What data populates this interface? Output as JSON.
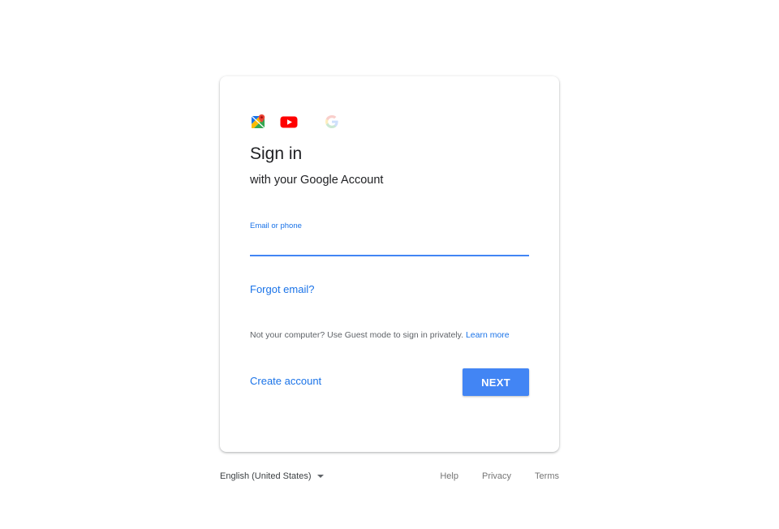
{
  "card": {
    "logos": [
      "maps-icon",
      "youtube-icon",
      "google-icon"
    ],
    "title": "Sign in",
    "subtitle": "with your Google Account",
    "email_field": {
      "label": "Email or phone",
      "value": "",
      "accent_color": "#4285f4"
    },
    "forgot_email": "Forgot email?",
    "guest_text": "Not your computer? Use Guest mode to sign in privately.",
    "learn_more": "Learn more",
    "create_account": "Create account",
    "next_button": "NEXT"
  },
  "footer": {
    "language": "English (United States)",
    "links": [
      "Help",
      "Privacy",
      "Terms"
    ]
  },
  "colors": {
    "primary": "#4285f4",
    "link": "#1a73e8",
    "text": "#202124"
  }
}
